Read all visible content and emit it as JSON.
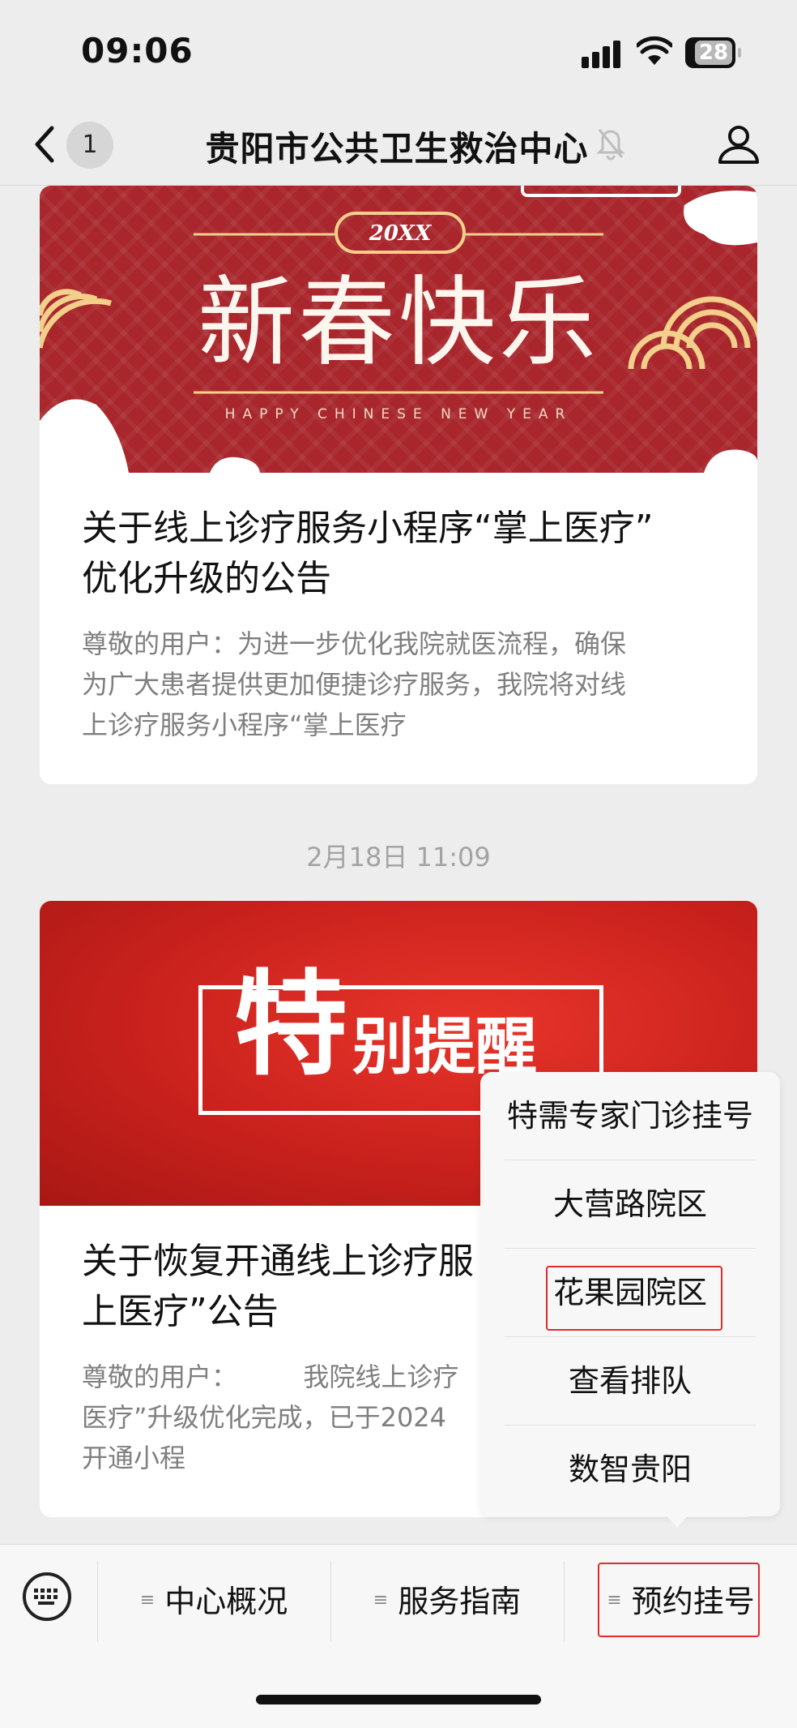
{
  "status_bar": {
    "time": "09:06",
    "battery": "28"
  },
  "nav": {
    "unread_count": "1",
    "title": "贵阳市公共卫生救治中心"
  },
  "articles": [
    {
      "banner": {
        "year_badge": "20XX",
        "headline": "新春快乐",
        "subline": "HAPPY CHINESE NEW YEAR"
      },
      "title_line1": "关于线上诊疗服务小程序“掌上医疗”",
      "title_line2": "优化升级的公告",
      "desc_line1": "尊敬的用户：为进一步优化我院就医流程，确保",
      "desc_line2": "为广大患者提供更加便捷诊疗服务，我院将对线",
      "desc_line3": "上诊疗服务小程序“掌上医疗"
    },
    {
      "banner": {
        "big_char": "特",
        "rest": "别提醒"
      },
      "title_line1": "关于恢复开通线上诊疗服",
      "title_line2": "上医疗”公告",
      "desc_line1": "尊敬的用户：        我院线上诊疗",
      "desc_line2": "医疗”升级优化完成，已于2024",
      "desc_line3": "开通小程"
    }
  ],
  "timestamp": "2月18日 11:09",
  "popup_menu": {
    "items": [
      "特需专家门诊挂号",
      "大营路院区",
      "花果园院区",
      "查看排队",
      "数智贵阳"
    ],
    "highlighted_index": 2
  },
  "bottom_menu": {
    "items": [
      "中心概况",
      "服务指南",
      "预约挂号"
    ],
    "highlighted_index": 2
  },
  "colors": {
    "highlight": "#e02b2b",
    "banner1": "#a8262c",
    "banner2": "#c9211d",
    "gold": "#f2cf8a"
  }
}
